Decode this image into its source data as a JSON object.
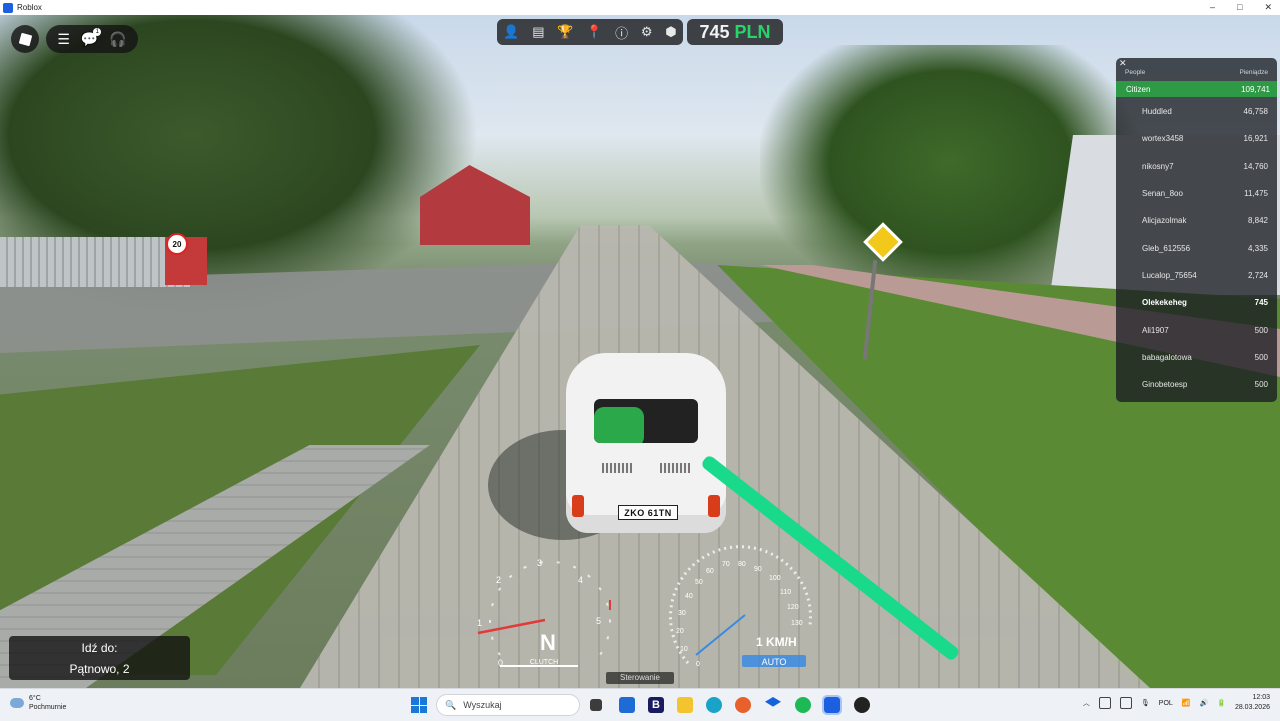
{
  "window": {
    "title": "Roblox",
    "controls": [
      "–",
      "□",
      "✕"
    ]
  },
  "roblox_menu": {
    "icons": [
      "roblox-logo-icon",
      "menu-icon",
      "chat-icon",
      "headset-icon"
    ],
    "chat_badge": "1"
  },
  "toolbar": {
    "icons": [
      "person-icon",
      "cards-icon",
      "trophy-icon",
      "location-pin-icon",
      "info-icon",
      "gear-icon",
      "shield-icon"
    ]
  },
  "money": {
    "amount": "745",
    "currency": "PLN",
    "currency_color": "#26d66a"
  },
  "leaderboard": {
    "close": "✕",
    "col_people": "People",
    "col_money": "Pieniądze",
    "team": {
      "name": "Citizen",
      "value": "109,741",
      "color": "#2f9a45"
    },
    "players": [
      {
        "name": "Huddled",
        "value": "46,758"
      },
      {
        "name": "wortex3458",
        "value": "16,921"
      },
      {
        "name": "nikosny7",
        "value": "14,760"
      },
      {
        "name": "Senan_8oo",
        "value": "11,475"
      },
      {
        "name": "Alicjazolmak",
        "value": "8,842"
      },
      {
        "name": "Gleb_612556",
        "value": "4,335"
      },
      {
        "name": "Lucalop_75654",
        "value": "2,724"
      },
      {
        "name": "Olekekeheg",
        "value": "745"
      },
      {
        "name": "Ali1907",
        "value": "500"
      },
      {
        "name": "babagalotowa",
        "value": "500"
      },
      {
        "name": "Ginobetoesp",
        "value": "500"
      }
    ]
  },
  "destination": {
    "label": "Idź do:",
    "address": "Pątnowo, 2"
  },
  "car": {
    "plate": "ZKO 61TN"
  },
  "dashboard": {
    "gear": "N",
    "clutch_label": "CLUTCH",
    "rpm_ticks": [
      "0",
      "1",
      "2",
      "3",
      "4",
      "5"
    ],
    "speed_ticks": [
      "0",
      "10",
      "20",
      "30",
      "40",
      "50",
      "60",
      "70",
      "80",
      "90",
      "100",
      "110",
      "120",
      "130"
    ],
    "speed": "1 KM/H",
    "mode": "AUTO",
    "steering_label": "Sterowanie"
  },
  "taskbar": {
    "weather_temp": "6°C",
    "weather_desc": "Pochmurnie",
    "search_placeholder": "Wyszukaj",
    "apps": [
      "task-view-icon",
      "store-icon",
      "bitdefender-icon",
      "file-explorer-icon",
      "edge-icon",
      "firefox-icon",
      "dropbox-icon",
      "spotify-icon",
      "roblox-icon",
      "roblox-studio-icon"
    ],
    "language": "POL",
    "time": "12:03",
    "date": "28.03.2026"
  }
}
